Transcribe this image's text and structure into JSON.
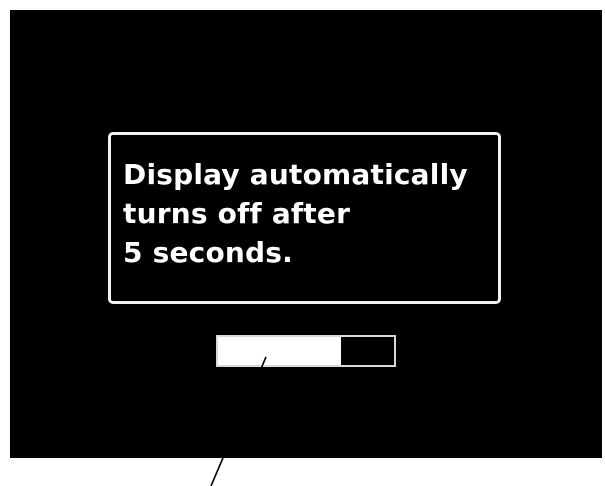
{
  "screen": {
    "background": "#000000",
    "message": {
      "lines": [
        "Display automatically",
        "turns off after",
        "5 seconds."
      ],
      "text_color": "#ffffff",
      "border_color": "#f2f2f2"
    },
    "countdown_bar": {
      "level": 0.7,
      "fill_color": "#ffffff",
      "track_color": "#000000"
    }
  }
}
